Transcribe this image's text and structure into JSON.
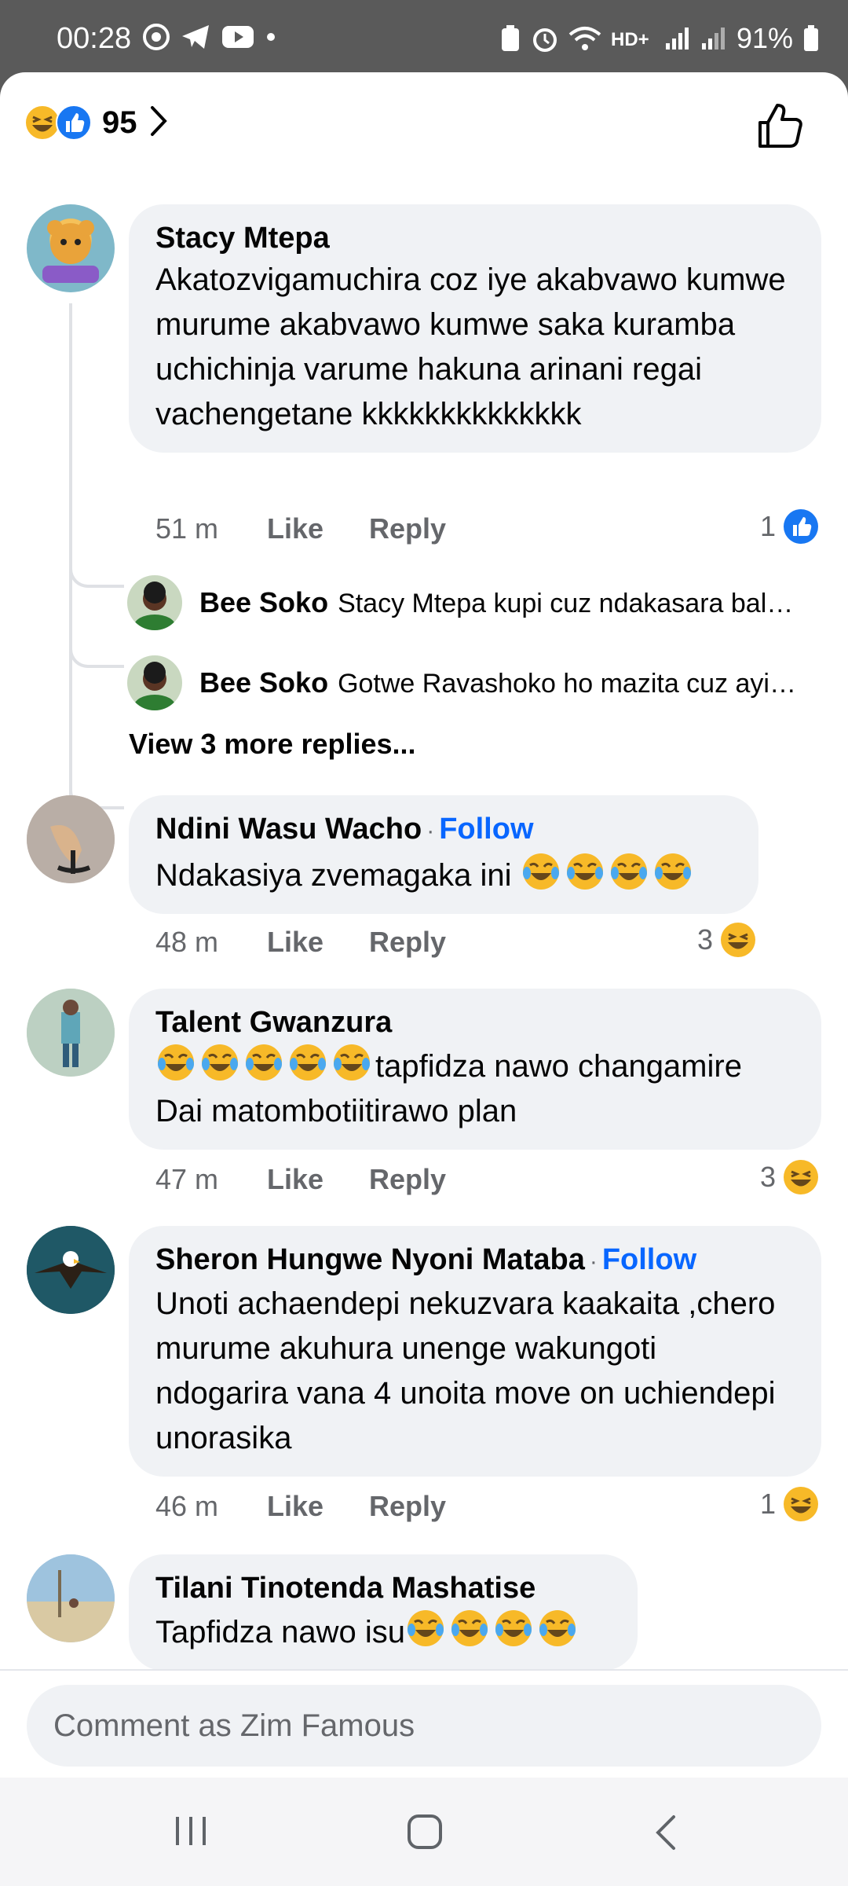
{
  "status_bar": {
    "time": "00:28",
    "battery": "91%",
    "left_icons": [
      "chrome-icon",
      "telegram-icon",
      "youtube-icon",
      "dot-icon"
    ],
    "right_icons": [
      "battery-saver-icon",
      "alarm-icon",
      "wifi-icon",
      "hd-call-icon",
      "signal-icon",
      "signal-icon",
      "battery-icon"
    ]
  },
  "header": {
    "reaction_count": "95",
    "reaction_icons": [
      "laugh-emoji",
      "like-icon"
    ]
  },
  "comments": [
    {
      "author": "Stacy Mtepa",
      "text": "Akatozvigamuchira coz iye akabvawo kumwe murume akabvawo kumwe saka kuramba uchichinja varume hakuna arinani regai vachengetane kkkkkkkkkkkkkk",
      "time": "51 m",
      "like": "Like",
      "reply": "Reply",
      "reaction_count": "1",
      "reaction_icon": "like-icon",
      "follow": ""
    },
    {
      "author": "Ndini Wasu Wacho",
      "text": "Ndakasiya zvemagaka ini ",
      "time": "48 m",
      "like": "Like",
      "reply": "Reply",
      "reaction_count": "3",
      "reaction_icon": "laugh-emoji",
      "follow": "Follow"
    },
    {
      "author": "Talent Gwanzura",
      "text": "tapfidza nawo changamire Dai matombotiitirawo plan",
      "time": "47 m",
      "like": "Like",
      "reply": "Reply",
      "reaction_count": "3",
      "reaction_icon": "laugh-emoji",
      "follow": ""
    },
    {
      "author": "Sheron Hungwe Nyoni Mataba",
      "text": "Unoti achaendepi nekuzvara kaakaita ,chero murume akuhura unenge wakungoti ndogarira vana 4 unoita move on uchiendepi unorasika",
      "time": "46 m",
      "like": "Like",
      "reply": "Reply",
      "reaction_count": "1",
      "reaction_icon": "laugh-emoji",
      "follow": "Follow"
    },
    {
      "author": "Tilani Tinotenda Mashatise",
      "text": "Tapfidza nawo isu",
      "follow": ""
    }
  ],
  "replies": [
    {
      "author": "Bee Soko",
      "text": "Stacy Mtepa kupi cuz ndakasara bal…"
    },
    {
      "author": "Bee Soko",
      "text": "Gotwe Ravashoko ho mazita cuz ayi…"
    }
  ],
  "view_more": "View 3 more replies...",
  "composer": {
    "placeholder": "Comment as Zim Famous"
  },
  "colors": {
    "accent": "#0866ff",
    "bubble": "#f0f2f5",
    "meta": "#65676b"
  }
}
